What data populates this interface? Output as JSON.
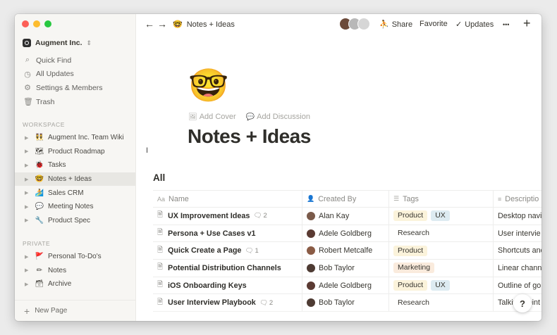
{
  "sidebar": {
    "workspace_name": "Augment Inc.",
    "nav": [
      {
        "label": "Quick Find",
        "icon": "search-icon",
        "glyph": "⌕"
      },
      {
        "label": "All Updates",
        "icon": "clock-icon",
        "glyph": "◷"
      },
      {
        "label": "Settings & Members",
        "icon": "gear-icon",
        "glyph": "⚙"
      },
      {
        "label": "Trash",
        "icon": "trash-icon",
        "glyph": "🗑"
      }
    ],
    "workspace_label": "WORKSPACE",
    "workspace_pages": [
      {
        "label": "Augment Inc. Team Wiki",
        "emoji": "👯"
      },
      {
        "label": "Product Roadmap",
        "emoji": "🗺"
      },
      {
        "label": "Tasks",
        "emoji": "🐞"
      },
      {
        "label": "Notes + Ideas",
        "emoji": "🤓"
      },
      {
        "label": "Sales CRM",
        "emoji": "🏄"
      },
      {
        "label": "Meeting Notes",
        "emoji": "💬"
      },
      {
        "label": "Product Spec",
        "emoji": "🔧"
      }
    ],
    "private_label": "PRIVATE",
    "private_pages": [
      {
        "label": "Personal To-Do's",
        "emoji": "🚩"
      },
      {
        "label": "Notes",
        "emoji": "✏"
      },
      {
        "label": "Archive",
        "emoji": "🗃"
      }
    ],
    "new_page_label": "New Page"
  },
  "topbar": {
    "back_glyph": "←",
    "forward_glyph": "→",
    "page_emoji": "🤓",
    "page_title": "Notes + Ideas",
    "share_label": "Share",
    "favorite_label": "Favorite",
    "updates_label": "Updates",
    "more_glyph": "•••",
    "add_glyph": "+"
  },
  "page": {
    "icon_emoji": "🤓",
    "add_cover_label": "Add Cover",
    "add_discussion_label": "Add Discussion",
    "title": "Notes + Ideas",
    "view_name": "All"
  },
  "table": {
    "headers": [
      "Name",
      "Created By",
      "Tags",
      "Descriptio"
    ],
    "rows": [
      {
        "name": "UX Improvement Ideas",
        "comments": "2",
        "created_by": "Alan Kay",
        "tags": [
          "Product",
          "UX"
        ],
        "description": "Desktop navi"
      },
      {
        "name": "Persona + Use Cases v1",
        "comments": "",
        "created_by": "Adele Goldberg",
        "tags": [
          "Research"
        ],
        "description": "User intervie"
      },
      {
        "name": "Quick Create a Page",
        "comments": "1",
        "created_by": "Robert Metcalfe",
        "tags": [
          "Product"
        ],
        "description": "Shortcuts and"
      },
      {
        "name": "Potential Distribution Channels",
        "comments": "",
        "created_by": "Bob Taylor",
        "tags": [
          "Marketing"
        ],
        "description": "Linear channe"
      },
      {
        "name": "iOS Onboarding Keys",
        "comments": "",
        "created_by": "Adele Goldberg",
        "tags": [
          "Product",
          "UX"
        ],
        "description": "Outline of go"
      },
      {
        "name": "User Interview Playbook",
        "comments": "2",
        "created_by": "Bob Taylor",
        "tags": [
          "Research"
        ],
        "description": "Talking point"
      }
    ]
  },
  "tag_colors": {
    "Product": "#fbf3db",
    "UX": "#ddebf1",
    "Research": "#ffffff",
    "Marketing": "#faebdd"
  },
  "avatar_colors": {
    "Alan Kay": "#7a5a4a",
    "Adele Goldberg": "#5a3a32",
    "Robert Metcalfe": "#8a5b45",
    "Bob Taylor": "#4e3b33"
  },
  "help_label": "?"
}
